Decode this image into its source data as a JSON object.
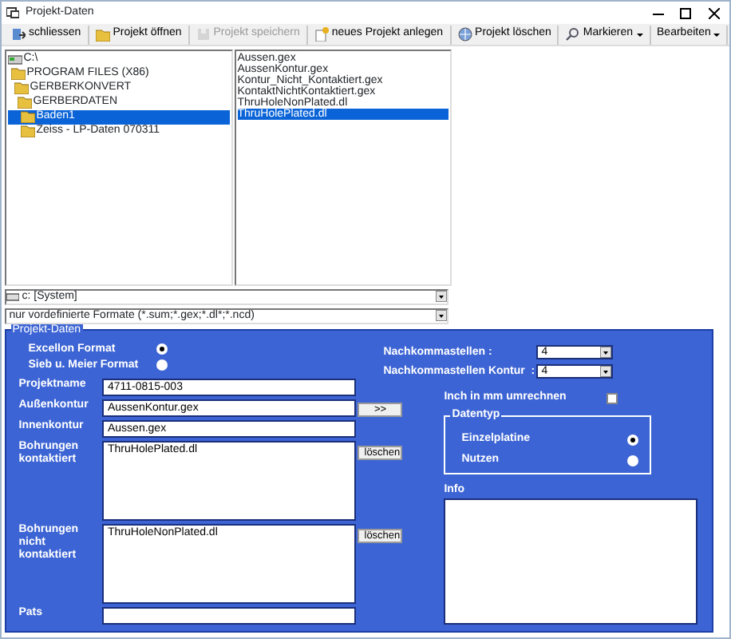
{
  "window": {
    "title": "Projekt-Daten"
  },
  "toolbar": [
    {
      "label": "schliessen",
      "kind": "exit",
      "disabled": false,
      "dropdown": false
    },
    {
      "label": "Projekt öffnen",
      "kind": "open",
      "disabled": false,
      "dropdown": false
    },
    {
      "label": "Projekt speichern",
      "kind": "save",
      "disabled": true,
      "dropdown": false
    },
    {
      "label": "neues Projekt anlegen",
      "kind": "new",
      "disabled": false,
      "dropdown": false
    },
    {
      "label": "Projekt löschen",
      "kind": "delete",
      "disabled": false,
      "dropdown": false
    },
    {
      "label": "Markieren",
      "kind": "search",
      "disabled": false,
      "dropdown": true
    },
    {
      "label": "Bearbeiten",
      "kind": "plain",
      "disabled": false,
      "dropdown": true
    }
  ],
  "tree": [
    {
      "label": "C:\\",
      "kind": "drive",
      "selected": false,
      "children": [
        {
          "label": "PROGRAM FILES (X86)",
          "kind": "folder",
          "selected": false,
          "children": [
            {
              "label": "GERBERKONVERT",
              "kind": "folder",
              "selected": false,
              "children": [
                {
                  "label": "GERBERDATEN",
                  "kind": "folder",
                  "selected": false,
                  "children": [
                    {
                      "label": "Baden1",
                      "kind": "folder",
                      "selected": true
                    },
                    {
                      "label": "Zeiss - LP-Daten 070311",
                      "kind": "folder",
                      "selected": false
                    }
                  ]
                }
              ]
            }
          ]
        }
      ]
    }
  ],
  "files": [
    {
      "label": "Aussen.gex",
      "selected": false
    },
    {
      "label": "AussenKontur.gex",
      "selected": false
    },
    {
      "label": "Kontur_Nicht_Kontaktiert.gex",
      "selected": false
    },
    {
      "label": "KontaktNichtKontaktiert.gex",
      "selected": false
    },
    {
      "label": "ThruHoleNonPlated.dl",
      "selected": false
    },
    {
      "label": "ThruHolePlated.dl",
      "selected": true
    }
  ],
  "drive": {
    "value": "c: [System]"
  },
  "filter": {
    "value": "nur vordefinierte Formate (*.sum;*.gex;*.dl*;*.ncd)"
  },
  "panel": {
    "title": "Projekt-Daten",
    "formats": [
      {
        "label": "Excellon Format",
        "selected": true
      },
      {
        "label": "Sieb u. Meier Format",
        "selected": false
      }
    ],
    "decimals": [
      {
        "label": "Nachkommastellen :",
        "value": "4"
      },
      {
        "label": "Nachkommastellen Kontur  :",
        "value": "4"
      }
    ],
    "fields": [
      {
        "label": "Projektname",
        "value": "4711-0815-003",
        "kind": "input"
      },
      {
        "label": "Außenkontur",
        "value": "AussenKontur.gex",
        "kind": "input",
        "button": ">>"
      },
      {
        "label": "Innenkontur",
        "value": "Aussen.gex",
        "kind": "input"
      },
      {
        "label": "Bohrungen kontaktiert",
        "value": "ThruHolePlated.dl",
        "kind": "area",
        "button": "löschen"
      },
      {
        "label": "Bohrungen nicht kontaktiert",
        "value": "ThruHoleNonPlated.dl",
        "kind": "area",
        "button": "löschen"
      },
      {
        "label": "Pats",
        "kind": "input"
      }
    ],
    "convert": {
      "label": "Inch in mm umrechnen",
      "checked": false
    },
    "datatype": {
      "title": "Datentyp",
      "options": [
        {
          "label": "Einzelplatine",
          "selected": true
        },
        {
          "label": "Nutzen",
          "selected": false
        }
      ]
    },
    "info": {
      "label": "Info"
    }
  }
}
